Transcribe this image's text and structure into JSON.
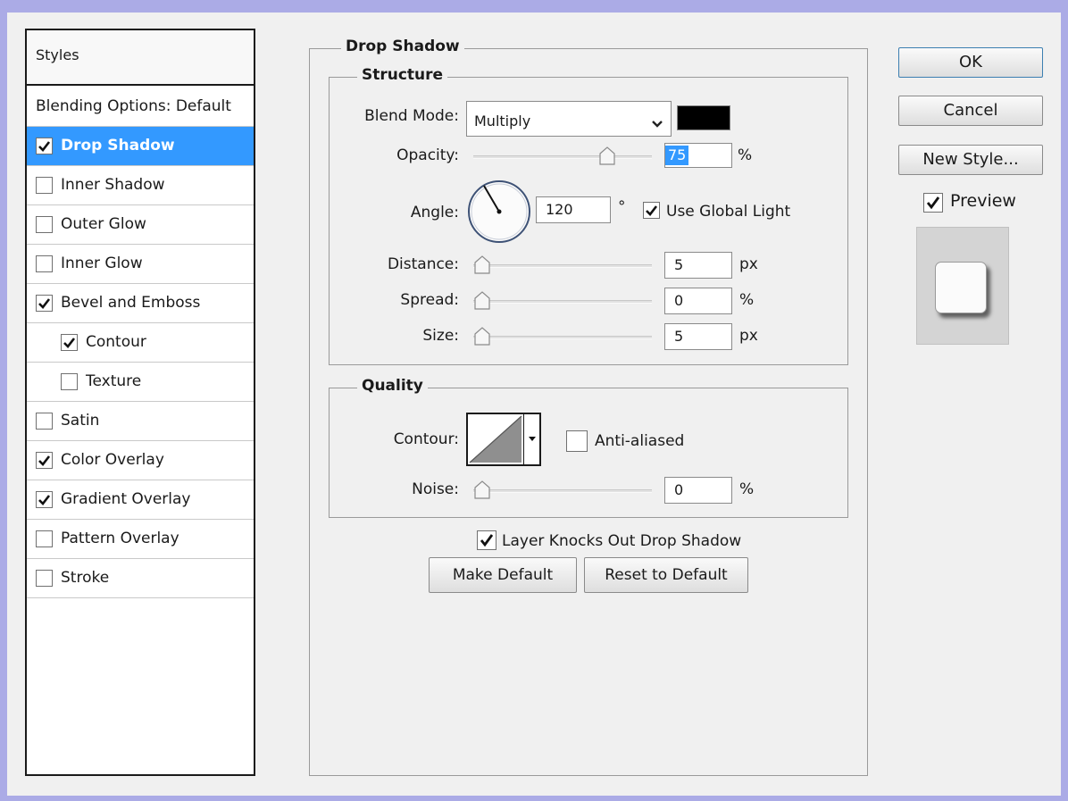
{
  "styles": {
    "header": "Styles",
    "items": [
      {
        "label": "Blending Options: Default",
        "checkbox": false,
        "checked": false,
        "selected": false,
        "indent": false
      },
      {
        "label": "Drop Shadow",
        "checkbox": true,
        "checked": true,
        "selected": true,
        "indent": false
      },
      {
        "label": "Inner Shadow",
        "checkbox": true,
        "checked": false,
        "selected": false,
        "indent": false
      },
      {
        "label": "Outer Glow",
        "checkbox": true,
        "checked": false,
        "selected": false,
        "indent": false
      },
      {
        "label": "Inner Glow",
        "checkbox": true,
        "checked": false,
        "selected": false,
        "indent": false
      },
      {
        "label": "Bevel and Emboss",
        "checkbox": true,
        "checked": true,
        "selected": false,
        "indent": false
      },
      {
        "label": "Contour",
        "checkbox": true,
        "checked": true,
        "selected": false,
        "indent": true
      },
      {
        "label": "Texture",
        "checkbox": true,
        "checked": false,
        "selected": false,
        "indent": true
      },
      {
        "label": "Satin",
        "checkbox": true,
        "checked": false,
        "selected": false,
        "indent": false
      },
      {
        "label": "Color Overlay",
        "checkbox": true,
        "checked": true,
        "selected": false,
        "indent": false
      },
      {
        "label": "Gradient Overlay",
        "checkbox": true,
        "checked": true,
        "selected": false,
        "indent": false
      },
      {
        "label": "Pattern Overlay",
        "checkbox": true,
        "checked": false,
        "selected": false,
        "indent": false
      },
      {
        "label": "Stroke",
        "checkbox": true,
        "checked": false,
        "selected": false,
        "indent": false
      }
    ]
  },
  "drop_shadow": {
    "title": "Drop Shadow",
    "structure": {
      "title": "Structure",
      "blend_mode_label": "Blend Mode:",
      "blend_mode_value": "Multiply",
      "shadow_color": "#000000",
      "opacity_label": "Opacity:",
      "opacity_value": "75",
      "opacity_unit": "%",
      "opacity_fraction": 0.75,
      "angle_label": "Angle:",
      "angle_value": "120",
      "angle_unit": "°",
      "use_global_light_label": "Use Global Light",
      "use_global_light_checked": true,
      "distance_label": "Distance:",
      "distance_value": "5",
      "distance_unit": "px",
      "spread_label": "Spread:",
      "spread_value": "0",
      "spread_unit": "%",
      "size_label": "Size:",
      "size_value": "5",
      "size_unit": "px"
    },
    "quality": {
      "title": "Quality",
      "contour_label": "Contour:",
      "anti_aliased_label": "Anti-aliased",
      "anti_aliased_checked": false,
      "noise_label": "Noise:",
      "noise_value": "0",
      "noise_unit": "%"
    },
    "layer_knocks_out_label": "Layer Knocks Out Drop Shadow",
    "layer_knocks_out_checked": true,
    "make_default_label": "Make Default",
    "reset_default_label": "Reset to Default"
  },
  "buttons": {
    "ok": "OK",
    "cancel": "Cancel",
    "new_style": "New Style...",
    "preview_label": "Preview",
    "preview_checked": true
  },
  "colors": {
    "selection": "#3399ff",
    "background": "#f0f0f0",
    "frame": "#ababe6"
  }
}
